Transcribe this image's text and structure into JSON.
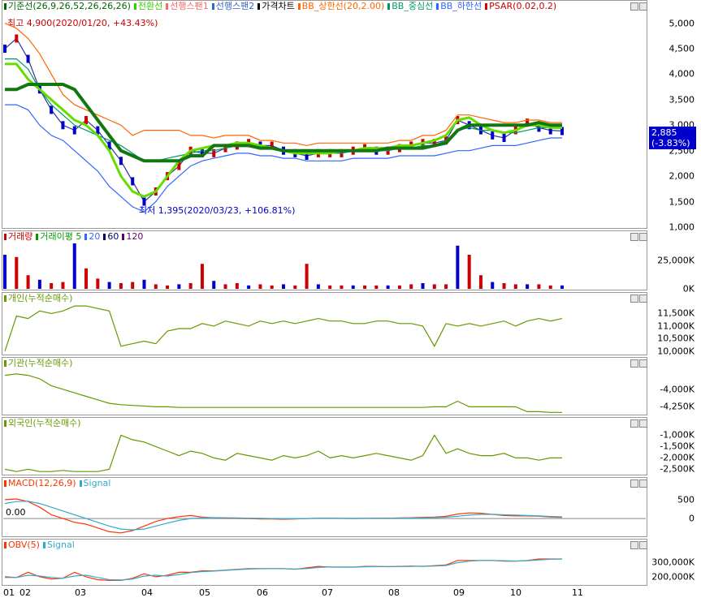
{
  "legends": {
    "price": [
      {
        "text": "기준선(26,9,26,52,26,26,26)",
        "color": "#006600"
      },
      {
        "text": "전환선",
        "color": "#33cc00"
      },
      {
        "text": "선행스팬1",
        "color": "#ff6666"
      },
      {
        "text": "선행스팬2",
        "color": "#3366cc"
      },
      {
        "text": "가격차트",
        "color": "#000000"
      },
      {
        "text": "BB_상한선(20,2.00)",
        "color": "#ff6600"
      },
      {
        "text": "BB_중심선",
        "color": "#009966"
      },
      {
        "text": "BB_하한선",
        "color": "#3366ff"
      },
      {
        "text": "PSAR(0.02,0.2)",
        "color": "#cc0000"
      }
    ],
    "volume": [
      {
        "text": "거래량",
        "color": "#cc0000"
      },
      {
        "text": "거래이평 5",
        "color": "#009900"
      },
      {
        "text": "20",
        "color": "#3366ff"
      },
      {
        "text": "60",
        "color": "#000066"
      },
      {
        "text": "120",
        "color": "#660066"
      }
    ],
    "individual": [
      {
        "text": "개인(누적순매수)",
        "color": "#669900"
      }
    ],
    "institution": [
      {
        "text": "기관(누적순매수)",
        "color": "#669900"
      }
    ],
    "foreign": [
      {
        "text": "외국인(누적순매수)",
        "color": "#669900"
      }
    ],
    "macd": [
      {
        "text": "MACD(12,26,9)",
        "color": "#ff3300"
      },
      {
        "text": "Signal",
        "color": "#33aacc"
      }
    ],
    "obv": [
      {
        "text": "OBV(5)",
        "color": "#ff3300"
      },
      {
        "text": "Signal",
        "color": "#33aacc"
      }
    ]
  },
  "annotations": {
    "high": "최고 4,900(2020/01/20, +43.43%)",
    "low": "최저 1,395(2020/03/23, +106.81%)",
    "macd_zero": "0.00"
  },
  "price_box": {
    "price": "2,885",
    "change": "(-3.83%)"
  },
  "chart_data": {
    "type": "line",
    "x_months": [
      "01",
      "02",
      "03",
      "04",
      "05",
      "06",
      "07",
      "08",
      "09",
      "10",
      "11"
    ],
    "panels": [
      {
        "id": "price",
        "ylim": [
          1000,
          5200
        ],
        "ticks": [
          "5,000",
          "4,500",
          "4,000",
          "3,500",
          "3,000",
          "2,500",
          "2,000",
          "1,500",
          "1,000"
        ],
        "tick_values": [
          5000,
          4500,
          4000,
          3500,
          3000,
          2500,
          2000,
          1500,
          1000
        ],
        "series": [
          {
            "name": "가격차트",
            "values": [
              4500,
              4700,
              4300,
              3700,
              3300,
              3000,
              2900,
              3100,
              2900,
              2600,
              2300,
              1900,
              1500,
              1700,
              2000,
              2200,
              2500,
              2450,
              2450,
              2550,
              2600,
              2650,
              2600,
              2600,
              2500,
              2450,
              2400,
              2450,
              2450,
              2450,
              2500,
              2550,
              2500,
              2500,
              2550,
              2600,
              2650,
              2650,
              2700,
              3100,
              3000,
              2900,
              2800,
              2750,
              2900,
              3050,
              2950,
              2900,
              2885
            ]
          },
          {
            "name": "BB_상한선",
            "values": [
              5000,
              4900,
              4700,
              4400,
              4000,
              3600,
              3400,
              3300,
              3200,
              3100,
              3000,
              2800,
              2900,
              2900,
              2900,
              2900,
              2800,
              2800,
              2750,
              2800,
              2800,
              2800,
              2700,
              2700,
              2650,
              2650,
              2600,
              2650,
              2650,
              2650,
              2650,
              2650,
              2650,
              2650,
              2700,
              2700,
              2800,
              2800,
              2900,
              3200,
              3200,
              3150,
              3100,
              3050,
              3050,
              3100,
              3100,
              3050,
              3050
            ]
          },
          {
            "name": "BB_중심선",
            "values": [
              4300,
              4300,
              4100,
              3700,
              3400,
              3200,
              3000,
              2900,
              2800,
              2700,
              2600,
              2450,
              2300,
              2300,
              2350,
              2400,
              2450,
              2500,
              2500,
              2550,
              2600,
              2600,
              2550,
              2550,
              2500,
              2500,
              2450,
              2450,
              2450,
              2450,
              2500,
              2500,
              2500,
              2500,
              2550,
              2550,
              2600,
              2600,
              2700,
              2900,
              2950,
              2900,
              2900,
              2850,
              2850,
              2900,
              2950,
              2950,
              2950
            ]
          },
          {
            "name": "BB_하한선",
            "values": [
              3400,
              3400,
              3300,
              3000,
              2800,
              2700,
              2500,
              2300,
              2100,
              1800,
              1600,
              1400,
              1300,
              1500,
              1800,
              2000,
              2200,
              2300,
              2350,
              2400,
              2450,
              2450,
              2400,
              2400,
              2350,
              2350,
              2300,
              2300,
              2300,
              2300,
              2350,
              2350,
              2350,
              2350,
              2400,
              2400,
              2400,
              2400,
              2450,
              2500,
              2500,
              2550,
              2600,
              2600,
              2600,
              2650,
              2700,
              2750,
              2750
            ]
          },
          {
            "name": "전환선",
            "values": [
              4200,
              4200,
              3900,
              3700,
              3500,
              3300,
              3100,
              3000,
              2800,
              2500,
              2000,
              1700,
              1600,
              1700,
              2000,
              2300,
              2500,
              2550,
              2600,
              2600,
              2650,
              2650,
              2600,
              2550,
              2500,
              2450,
              2450,
              2450,
              2450,
              2500,
              2500,
              2550,
              2550,
              2550,
              2600,
              2600,
              2650,
              2700,
              2800,
              3100,
              3150,
              3000,
              2900,
              2850,
              2900,
              3000,
              3000,
              2950,
              2950
            ]
          },
          {
            "name": "기준선",
            "values": [
              3700,
              3700,
              3800,
              3800,
              3800,
              3800,
              3700,
              3400,
              3100,
              2800,
              2500,
              2400,
              2300,
              2300,
              2300,
              2300,
              2400,
              2400,
              2600,
              2600,
              2600,
              2600,
              2550,
              2550,
              2500,
              2500,
              2500,
              2500,
              2500,
              2500,
              2500,
              2500,
              2500,
              2550,
              2550,
              2550,
              2550,
              2600,
              2650,
              2900,
              3000,
              3000,
              3000,
              3000,
              3000,
              3000,
              3050,
              3000,
              3000
            ]
          }
        ]
      },
      {
        "id": "volume",
        "ylim": [
          0,
          40000
        ],
        "ticks": [
          "25,000K",
          "0K"
        ],
        "tick_values": [
          25000,
          0
        ],
        "series": [
          {
            "name": "거래량",
            "values": [
              30000,
              28000,
              12000,
              8000,
              5000,
              6000,
              40000,
              18000,
              9000,
              6000,
              5000,
              6000,
              8000,
              4000,
              3000,
              4000,
              5000,
              22000,
              7000,
              4000,
              5000,
              3000,
              4000,
              3000,
              4000,
              3000,
              22000,
              4000,
              3000,
              3000,
              3000,
              3000,
              3000,
              3000,
              3000,
              4000,
              5000,
              4000,
              4000,
              38000,
              30000,
              12000,
              6000,
              5000,
              4000,
              4000,
              4000,
              3000,
              3000
            ]
          }
        ]
      },
      {
        "id": "individual",
        "ylim": [
          9900,
          11900
        ],
        "ticks": [
          "11,500K",
          "11,000K",
          "10,500K",
          "10,000K"
        ],
        "tick_values": [
          11500,
          11000,
          10500,
          10000
        ],
        "series": [
          {
            "name": "개인",
            "values": [
              10000,
              11400,
              11300,
              11600,
              11500,
              11600,
              11800,
              11800,
              11700,
              11600,
              10200,
              10300,
              10400,
              10300,
              10800,
              10900,
              10900,
              11100,
              11000,
              11200,
              11100,
              11000,
              11200,
              11100,
              11200,
              11100,
              11200,
              11300,
              11200,
              11200,
              11100,
              11100,
              11200,
              11200,
              11100,
              11100,
              11000,
              10200,
              11100,
              11000,
              11100,
              11000,
              11100,
              11200,
              11000,
              11200,
              11300,
              11200,
              11300
            ]
          }
        ]
      },
      {
        "id": "institution",
        "ylim": [
          -4350,
          -3700
        ],
        "ticks": [
          "-4,000K",
          "-4,250K"
        ],
        "tick_values": [
          -4000,
          -4250
        ],
        "series": [
          {
            "name": "기관",
            "values": [
              -3800,
              -3780,
              -3800,
              -3850,
              -3950,
              -4000,
              -4050,
              -4100,
              -4150,
              -4200,
              -4220,
              -4230,
              -4240,
              -4250,
              -4250,
              -4260,
              -4260,
              -4260,
              -4260,
              -4260,
              -4260,
              -4260,
              -4260,
              -4260,
              -4260,
              -4260,
              -4260,
              -4260,
              -4260,
              -4260,
              -4260,
              -4260,
              -4260,
              -4260,
              -4260,
              -4260,
              -4260,
              -4250,
              -4250,
              -4170,
              -4250,
              -4250,
              -4250,
              -4250,
              -4250,
              -4320,
              -4320,
              -4330,
              -4330
            ]
          }
        ]
      },
      {
        "id": "foreign",
        "ylim": [
          -2700,
          -700
        ],
        "ticks": [
          "-1,000K",
          "-1,500K",
          "-2,000K",
          "-2,500K"
        ],
        "tick_values": [
          -1000,
          -1500,
          -2000,
          -2500
        ],
        "series": [
          {
            "name": "외국인",
            "values": [
              -2500,
              -2600,
              -2500,
              -2600,
              -2600,
              -2550,
              -2600,
              -2600,
              -2600,
              -2500,
              -1000,
              -1200,
              -1300,
              -1500,
              -1700,
              -1900,
              -1700,
              -1800,
              -2000,
              -2100,
              -1800,
              -1900,
              -2000,
              -2100,
              -1900,
              -2000,
              -1900,
              -1700,
              -2000,
              -1900,
              -2000,
              -1900,
              -1800,
              -1900,
              -2000,
              -2100,
              -1900,
              -1000,
              -1800,
              -1600,
              -1800,
              -1900,
              -1900,
              -1800,
              -2000,
              -2000,
              -2100,
              -2000,
              -2000
            ]
          }
        ]
      },
      {
        "id": "macd",
        "ylim": [
          -450,
          800
        ],
        "ticks": [
          "500",
          "0"
        ],
        "tick_values": [
          500,
          0
        ],
        "series": [
          {
            "name": "MACD",
            "values": [
              500,
              520,
              450,
              300,
              100,
              0,
              -100,
              -150,
              -250,
              -350,
              -380,
              -320,
              -200,
              -80,
              0,
              50,
              80,
              40,
              20,
              10,
              5,
              0,
              -10,
              -10,
              -20,
              -10,
              0,
              10,
              10,
              5,
              0,
              5,
              10,
              10,
              15,
              20,
              30,
              40,
              60,
              120,
              150,
              140,
              110,
              80,
              70,
              70,
              60,
              40,
              30
            ]
          },
          {
            "name": "Signal",
            "values": [
              400,
              450,
              460,
              400,
              300,
              200,
              100,
              0,
              -100,
              -200,
              -280,
              -300,
              -280,
              -200,
              -120,
              -50,
              0,
              20,
              25,
              20,
              15,
              10,
              5,
              0,
              -5,
              -5,
              0,
              5,
              5,
              5,
              5,
              5,
              8,
              8,
              10,
              12,
              18,
              25,
              35,
              60,
              90,
              110,
              110,
              100,
              90,
              80,
              70,
              55,
              45
            ]
          }
        ]
      },
      {
        "id": "obv",
        "ylim": [
          150000,
          380000
        ],
        "ticks": [
          "300,000K",
          "200,000K"
        ],
        "tick_values": [
          300000,
          200000
        ],
        "series": [
          {
            "name": "OBV",
            "values": [
              200000,
              195000,
              230000,
              200000,
              185000,
              190000,
              230000,
              200000,
              180000,
              175000,
              175000,
              190000,
              220000,
              200000,
              210000,
              230000,
              230000,
              240000,
              240000,
              245000,
              250000,
              255000,
              255000,
              255000,
              255000,
              250000,
              260000,
              270000,
              265000,
              265000,
              265000,
              270000,
              270000,
              268000,
              270000,
              272000,
              270000,
              275000,
              280000,
              310000,
              310000,
              310000,
              310000,
              305000,
              305000,
              310000,
              320000,
              320000,
              320000
            ]
          },
          {
            "name": "Signal",
            "values": [
              195000,
              195000,
              210000,
              205000,
              195000,
              190000,
              205000,
              210000,
              195000,
              180000,
              178000,
              185000,
              205000,
              210000,
              205000,
              215000,
              228000,
              235000,
              238000,
              243000,
              248000,
              252000,
              254000,
              255000,
              255000,
              252000,
              255000,
              263000,
              266000,
              265000,
              265000,
              267000,
              269000,
              269000,
              269000,
              270000,
              271000,
              272000,
              276000,
              295000,
              305000,
              310000,
              310000,
              308000,
              306000,
              308000,
              314000,
              318000,
              320000
            ]
          }
        ]
      }
    ]
  }
}
